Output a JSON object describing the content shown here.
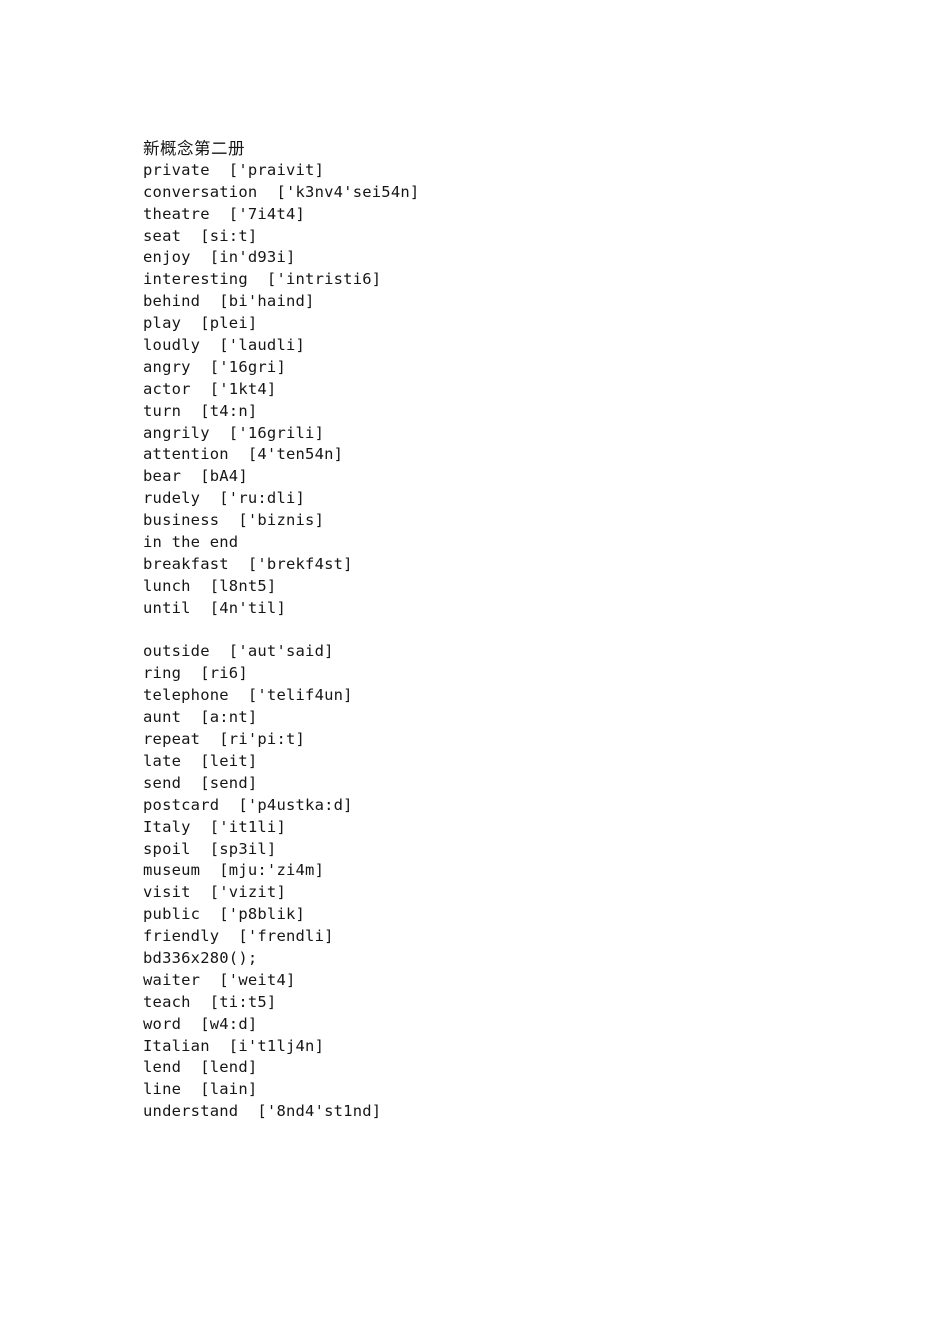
{
  "document": {
    "title": "新概念第二册",
    "background_color": "#ffffff",
    "text_color": "#161616",
    "lines": [
      {
        "id": "title",
        "text": "新概念第二册",
        "kind": "heading-cjk"
      },
      {
        "id": "private",
        "text": "private  ['praivit]",
        "kind": "entry"
      },
      {
        "id": "conversation",
        "text": "conversation  ['k3nv4'sei54n]",
        "kind": "entry"
      },
      {
        "id": "theatre",
        "text": "theatre  ['7i4t4]",
        "kind": "entry"
      },
      {
        "id": "seat",
        "text": "seat  [si:t]",
        "kind": "entry"
      },
      {
        "id": "enjoy",
        "text": "enjoy  [in'd93i]",
        "kind": "entry"
      },
      {
        "id": "interesting",
        "text": "interesting  ['intristi6]",
        "kind": "entry"
      },
      {
        "id": "behind",
        "text": "behind  [bi'haind]",
        "kind": "entry"
      },
      {
        "id": "play",
        "text": "play  [plei]",
        "kind": "entry"
      },
      {
        "id": "loudly",
        "text": "loudly  ['laudli]",
        "kind": "entry"
      },
      {
        "id": "angry",
        "text": "angry  ['16gri]",
        "kind": "entry"
      },
      {
        "id": "actor",
        "text": "actor  ['1kt4]",
        "kind": "entry"
      },
      {
        "id": "turn",
        "text": "turn  [t4:n]",
        "kind": "entry"
      },
      {
        "id": "angrily",
        "text": "angrily  ['16grili]",
        "kind": "entry"
      },
      {
        "id": "attention",
        "text": "attention  [4'ten54n]",
        "kind": "entry"
      },
      {
        "id": "bear",
        "text": "bear  [bA4]",
        "kind": "entry"
      },
      {
        "id": "rudely",
        "text": "rudely  ['ru:dli]",
        "kind": "entry"
      },
      {
        "id": "business",
        "text": "business  ['biznis]",
        "kind": "entry"
      },
      {
        "id": "in-the-end",
        "text": "in the end",
        "kind": "entry"
      },
      {
        "id": "breakfast",
        "text": "breakfast  ['brekf4st]",
        "kind": "entry"
      },
      {
        "id": "lunch",
        "text": "lunch  [l8nt5]",
        "kind": "entry"
      },
      {
        "id": "until",
        "text": "until  [4n'til]",
        "kind": "entry"
      },
      {
        "id": "spacer-1",
        "text": "",
        "kind": "blank"
      },
      {
        "id": "outside",
        "text": "outside  ['aut'said]",
        "kind": "entry"
      },
      {
        "id": "ring",
        "text": "ring  [ri6]",
        "kind": "entry"
      },
      {
        "id": "telephone",
        "text": "telephone  ['telif4un]",
        "kind": "entry"
      },
      {
        "id": "aunt",
        "text": "aunt  [a:nt]",
        "kind": "entry"
      },
      {
        "id": "repeat",
        "text": "repeat  [ri'pi:t]",
        "kind": "entry"
      },
      {
        "id": "late",
        "text": "late  [leit]",
        "kind": "entry"
      },
      {
        "id": "send",
        "text": "send  [send]",
        "kind": "entry"
      },
      {
        "id": "postcard",
        "text": "postcard  ['p4ustka:d]",
        "kind": "entry"
      },
      {
        "id": "italy",
        "text": "Italy  ['it1li]",
        "kind": "entry"
      },
      {
        "id": "spoil",
        "text": "spoil  [sp3il]",
        "kind": "entry"
      },
      {
        "id": "museum",
        "text": "museum  [mju:'zi4m]",
        "kind": "entry"
      },
      {
        "id": "visit",
        "text": "visit  ['vizit]",
        "kind": "entry"
      },
      {
        "id": "public",
        "text": "public  ['p8blik]",
        "kind": "entry"
      },
      {
        "id": "friendly",
        "text": "friendly  ['frendli]",
        "kind": "entry"
      },
      {
        "id": "ad-artifact",
        "text": "bd336x280();",
        "kind": "artifact"
      },
      {
        "id": "waiter",
        "text": "waiter  ['weit4]",
        "kind": "entry"
      },
      {
        "id": "teach",
        "text": "teach  [ti:t5]",
        "kind": "entry"
      },
      {
        "id": "word",
        "text": "word  [w4:d]",
        "kind": "entry"
      },
      {
        "id": "italian",
        "text": "Italian  [i't1lj4n]",
        "kind": "entry"
      },
      {
        "id": "lend",
        "text": "lend  [lend]",
        "kind": "entry"
      },
      {
        "id": "line",
        "text": "line  [lain]",
        "kind": "entry"
      },
      {
        "id": "understand",
        "text": "understand  ['8nd4'st1nd]",
        "kind": "entry"
      }
    ]
  }
}
